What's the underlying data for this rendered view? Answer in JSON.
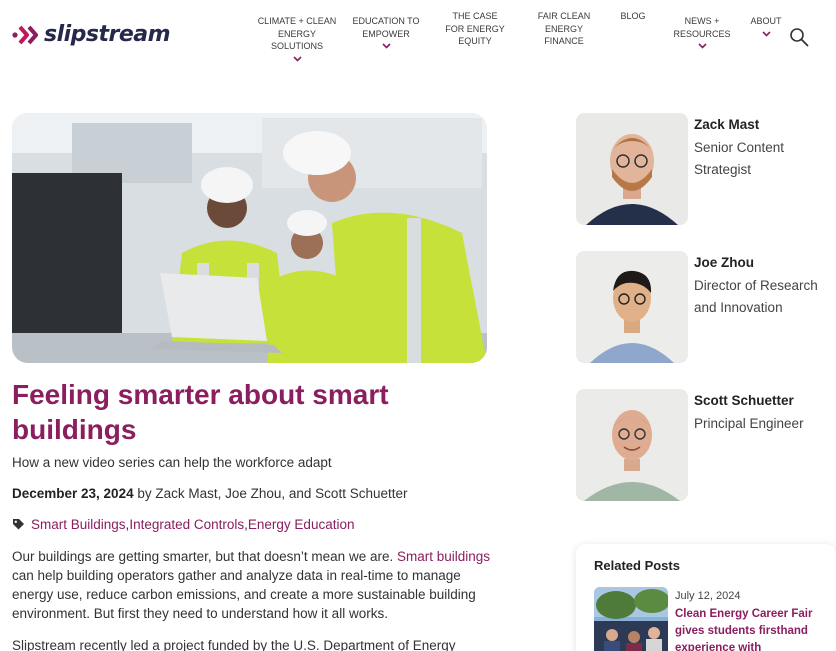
{
  "brand": {
    "name": "slipstream",
    "primary": "#8a1e5f",
    "dark": "#25284a"
  },
  "nav": [
    {
      "label": "CLIMATE + CLEAN\nENERGY\nSOLUTIONS",
      "dropdown": true
    },
    {
      "label": "EDUCATION TO\nEMPOWER",
      "dropdown": true
    },
    {
      "label": "THE CASE\nFOR ENERGY\nEQUITY",
      "dropdown": false
    },
    {
      "label": "FAIR CLEAN\nENERGY\nFINANCE",
      "dropdown": false
    },
    {
      "label": "BLOG",
      "dropdown": false
    },
    {
      "label": "NEWS +\nRESOURCES",
      "dropdown": true
    },
    {
      "label": "ABOUT",
      "dropdown": true
    }
  ],
  "article": {
    "title": "Feeling smarter about smart buildings",
    "subtitle": "How a new video series can help the workforce adapt",
    "date": "December 23, 2024",
    "byline": " by Zack Mast, Joe Zhou, and Scott Schuetter",
    "tags": [
      "Smart Buildings",
      "Integrated Controls",
      "Energy Education"
    ],
    "tag_separator": ", ",
    "p1_a": "Our buildings are getting smarter, but that doesn’t mean we are. ",
    "p1_link": "Smart buildings",
    "p1_b": " can help building operators gather and analyze data in real-time to manage energy use, reduce carbon emissions, and create a more sustainable building environment. But first they need to understand how it all works.",
    "p2": "Slipstream recently led a project funded by the U.S. Department of Energy"
  },
  "authors": [
    {
      "name": "Zack Mast",
      "role": "Senior Content Strategist"
    },
    {
      "name": "Joe Zhou",
      "role": "Director of Research and Innovation"
    },
    {
      "name": "Scott Schuetter",
      "role": "Principal Engineer"
    }
  ],
  "related": {
    "heading": "Related Posts",
    "items": [
      {
        "date": "July 12, 2024",
        "title": "Clean Energy Career Fair gives students firsthand experience with"
      }
    ]
  }
}
